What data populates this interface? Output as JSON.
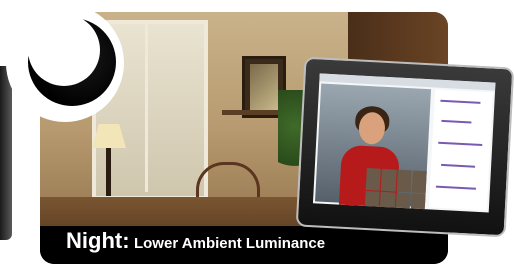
{
  "caption": {
    "lead": "Night:",
    "rest": "Lower Ambient Luminance"
  },
  "icons": {
    "moon": "crescent-moon-icon"
  },
  "colors": {
    "caption_background": "#000000",
    "caption_text": "#ffffff",
    "moon": "#000000"
  }
}
